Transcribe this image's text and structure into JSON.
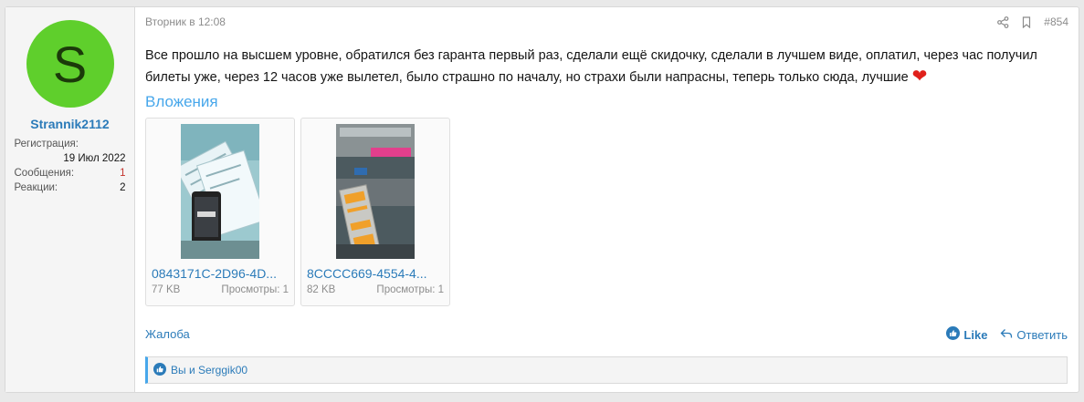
{
  "user": {
    "avatar_letter": "S",
    "avatar_color": "#5fcf2c",
    "name": "Strannik2112",
    "registration_label": "Регистрация:",
    "registration_date": "19 Июл 2022",
    "messages_label": "Сообщения:",
    "messages_count": "1",
    "reactions_label": "Реакции:",
    "reactions_count": "2"
  },
  "post": {
    "timestamp": "Вторник в 12:08",
    "number": "#854",
    "text": "Все прошло на высшем уровне, обратился без гаранта первый раз, сделали ещё скидочку, сделали в лучшем виде, оплатил, через час получил билеты уже, через 12 часов уже вылетел, было страшно по началу, но страхи были напрасны, теперь только сюда, лучшие",
    "emoji": "❤"
  },
  "attachments": {
    "title": "Вложения",
    "items": [
      {
        "name": "0843171C-2D96-4D...",
        "size": "77 KB",
        "views": "Просмотры: 1"
      },
      {
        "name": "8CCCC669-4554-4...",
        "size": "82 KB",
        "views": "Просмотры: 1"
      }
    ]
  },
  "actions": {
    "report": "Жалоба",
    "like": "Like",
    "reply": "Ответить"
  },
  "reactions_bar": {
    "text": "Вы и Serggik00"
  },
  "icons": {
    "share": "share-icon",
    "bookmark": "bookmark-icon",
    "like": "like-icon",
    "reply": "reply-icon"
  },
  "colors": {
    "accent": "#2b7bb9",
    "light_accent": "#47a7eb",
    "heart": "#e0201b"
  }
}
